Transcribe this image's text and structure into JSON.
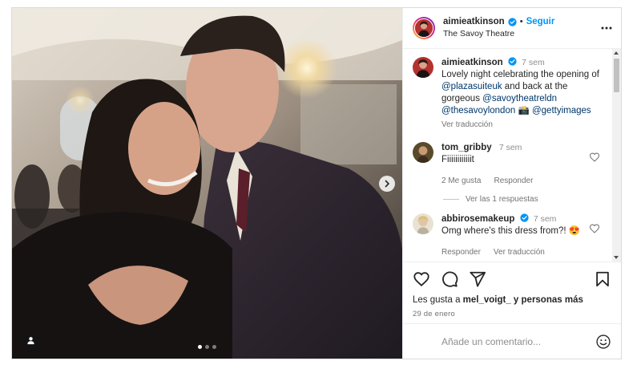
{
  "post": {
    "author": "aimieatkinson",
    "separator": "•",
    "follow_label": "Seguir",
    "location": "The Savoy Theatre",
    "icons": {
      "verified": "verified-badge-icon",
      "more": "more-options-icon",
      "next": "chevron-right-icon",
      "tags": "user-tag-icon"
    },
    "carousel": {
      "slides": 3,
      "active": 0
    }
  },
  "caption": {
    "username": "aimieatkinson",
    "time": "7 sem",
    "text_1": "Lovely night celebrating the opening of ",
    "mention_1": "@plazasuiteuk",
    "text_2": " and back at the gorgeous ",
    "mention_2": "@savoytheatreldn",
    "text_3": " ",
    "mention_3": "@thesavoylondon",
    "camera_emoji": "📸",
    "text_4": " ",
    "mention_4": "@gettyimages",
    "translate": "Ver traducción"
  },
  "comments": [
    {
      "username": "tom_gribby",
      "time": "7 sem",
      "text": "Fiiiiiiiiiiiit",
      "likes_label": "2 Me gusta",
      "reply_label": "Responder",
      "view_replies": "Ver las 1 respuestas"
    },
    {
      "username": "abbirosemakeup",
      "time": "7 sem",
      "text": "Omg where's this dress from?!",
      "emoji": "😍",
      "reply_label": "Responder",
      "translate": "Ver traducción"
    }
  ],
  "actions": {
    "icons": [
      "heart-icon",
      "comment-icon",
      "share-icon",
      "bookmark-icon"
    ],
    "likes_prefix": "Les gusta a ",
    "likes_user": "mel_voigt_",
    "likes_suffix": " y personas más",
    "date": "29 de enero"
  },
  "composer": {
    "placeholder": "Añade un comentario...",
    "emoji_icon": "smiley-icon"
  },
  "colors": {
    "accent": "#0095f6",
    "verified": "#0095f6",
    "mention": "#00376b",
    "muted": "#737373"
  }
}
